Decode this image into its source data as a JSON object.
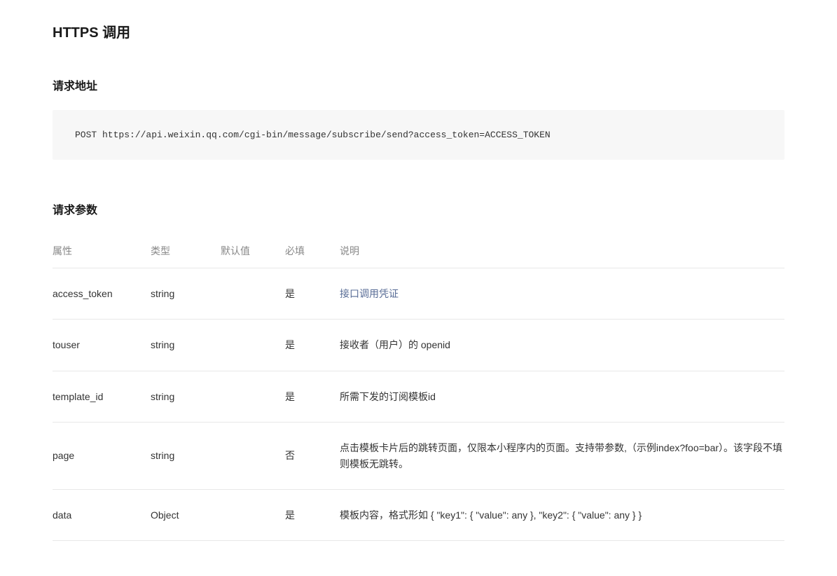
{
  "heading": "HTTPS 调用",
  "request_url_section": "请求地址",
  "request_url_code": "POST https://api.weixin.qq.com/cgi-bin/message/subscribe/send?access_token=ACCESS_TOKEN",
  "request_params_section": "请求参数",
  "table_headers": {
    "attr": "属性",
    "type": "类型",
    "default": "默认值",
    "required": "必填",
    "desc": "说明"
  },
  "rows": [
    {
      "attr": "access_token",
      "type": "string",
      "default": "",
      "required": "是",
      "desc": "接口调用凭证",
      "desc_link": true
    },
    {
      "attr": "touser",
      "type": "string",
      "default": "",
      "required": "是",
      "desc": "接收者（用户）的 openid"
    },
    {
      "attr": "template_id",
      "type": "string",
      "default": "",
      "required": "是",
      "desc": "所需下发的订阅模板id"
    },
    {
      "attr": "page",
      "type": "string",
      "default": "",
      "required": "否",
      "desc": "点击模板卡片后的跳转页面，仅限本小程序内的页面。支持带参数,（示例index?foo=bar）。该字段不填则模板无跳转。"
    },
    {
      "attr": "data",
      "type": "Object",
      "default": "",
      "required": "是",
      "desc": "模板内容，格式形如 { \"key1\": { \"value\": any }, \"key2\": { \"value\": any } }"
    }
  ]
}
